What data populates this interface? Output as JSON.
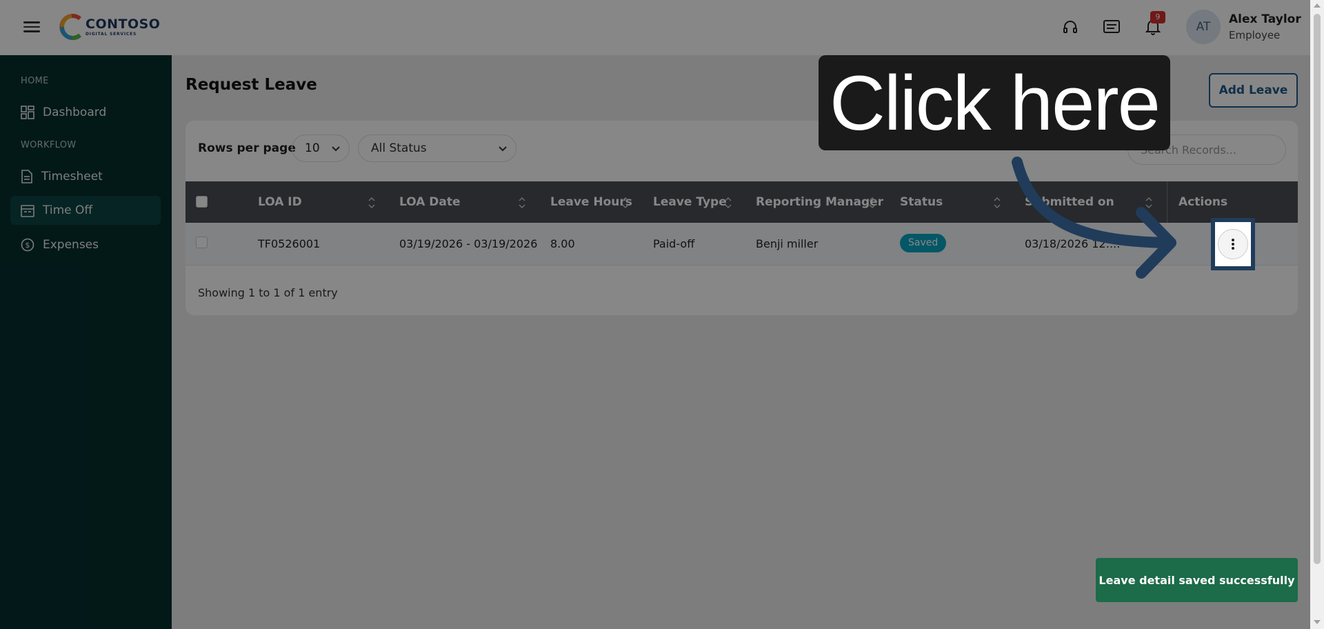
{
  "app": {
    "logo_name": "CONTOSO",
    "logo_sub": "DIGITAL SERVICES"
  },
  "header": {
    "notification_count": "9",
    "user_initials": "AT",
    "user_name": "Alex Taylor",
    "user_role": "Employee"
  },
  "sidebar": {
    "sections": {
      "home": "HOME",
      "workflow": "WORKFLOW"
    },
    "items": [
      {
        "label": "Dashboard",
        "icon": "dashboard-icon"
      },
      {
        "label": "Timesheet",
        "icon": "timesheet-icon"
      },
      {
        "label": "Time Off",
        "icon": "calendar-icon",
        "active": true
      },
      {
        "label": "Expenses",
        "icon": "dollar-icon"
      }
    ]
  },
  "main": {
    "title": "Request Leave",
    "add_button": "Add Leave",
    "rows_per_page_label": "Rows per page",
    "rows_per_page_value": "10",
    "status_filter_value": "All Status",
    "search_placeholder": "Search Records...",
    "columns": [
      "LOA ID",
      "LOA Date",
      "Leave Hours",
      "Leave Type",
      "Reporting Manager",
      "Status",
      "Submitted on",
      "Actions"
    ],
    "rows": [
      {
        "loa_id": "TF0526001",
        "loa_date": "03/19/2026 - 03/19/2026",
        "leave_hours": "8.00",
        "leave_type": "Paid-off",
        "manager": "Benji miller",
        "status": "Saved",
        "submitted_on": "03/18/2026 12:..."
      }
    ],
    "showing_text": "Showing 1 to 1 of 1 entry"
  },
  "overlay": {
    "callout_text": "Click here"
  },
  "toast": {
    "message": "Leave detail saved successfully"
  },
  "colors": {
    "sidebar_bg": "#06302f",
    "accent": "#1f5a8a",
    "status_saved": "#08a5c1",
    "toast_bg": "#1c6b49",
    "callout_arrow": "#203c5a"
  }
}
